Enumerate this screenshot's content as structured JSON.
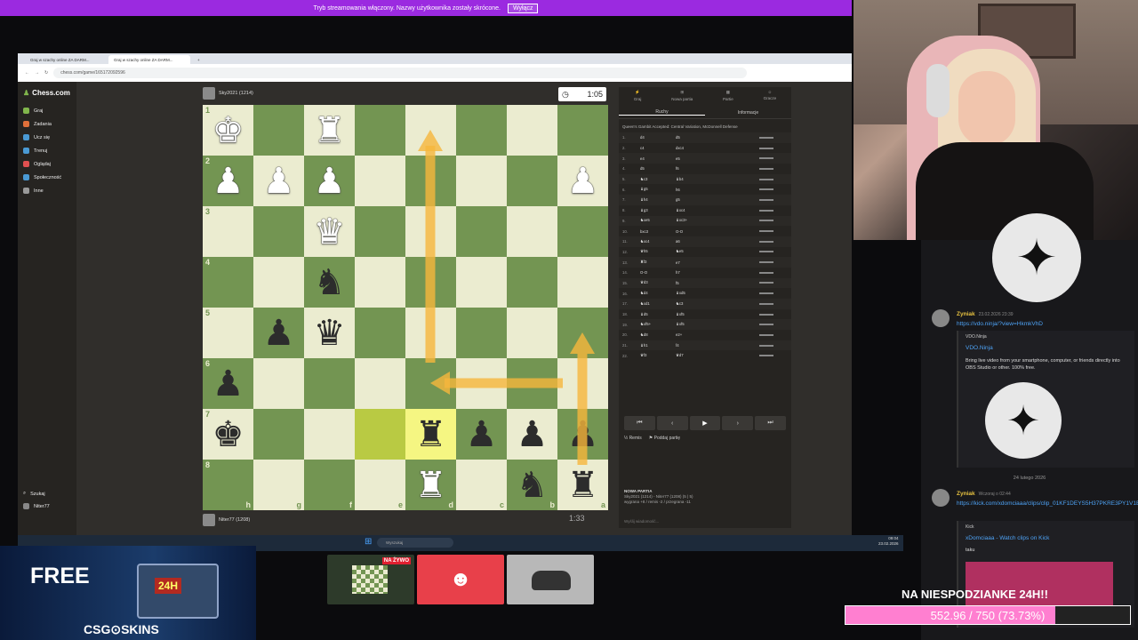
{
  "banner": {
    "text": "Tryb streamowania włączony. Nazwy użytkownika zostały skrócone.",
    "button": "Wyłącz"
  },
  "browser": {
    "tabs": [
      "Graj w szachy online ZA DARM...",
      "Graj w szachy online ZA DARM..."
    ],
    "url": "chess.com/game/165172092596"
  },
  "sidebar": {
    "logo": "Chess.com",
    "items": [
      {
        "label": "Graj",
        "color": "#81b64c"
      },
      {
        "label": "Zadania",
        "color": "#e0703a"
      },
      {
        "label": "Ucz się",
        "color": "#4a9ad4"
      },
      {
        "label": "Trenuj",
        "color": "#4a9ad4"
      },
      {
        "label": "Oglądaj",
        "color": "#e05050"
      },
      {
        "label": "Społeczność",
        "color": "#4a9ad4"
      },
      {
        "label": "Inne",
        "color": "#999999"
      }
    ],
    "search": "Szukaj",
    "user": "Niter77"
  },
  "top_player": {
    "name": "Sky2021 (1214)",
    "clock": "1:05"
  },
  "bottom_player": {
    "name": "Niter77 (1208)",
    "clock": "1:33"
  },
  "board": {
    "ranks": [
      "1",
      "2",
      "3",
      "4",
      "5",
      "6",
      "7",
      "8"
    ],
    "files": [
      "h",
      "g",
      "f",
      "e",
      "d",
      "c",
      "b",
      "a"
    ],
    "rows": [
      [
        "wK",
        "",
        "wR",
        "",
        "",
        "",
        "",
        ""
      ],
      [
        "wP",
        "wP",
        "wP",
        "",
        "",
        "",
        "",
        "wP"
      ],
      [
        "",
        "",
        "wQ",
        "",
        "",
        "",
        "",
        ""
      ],
      [
        "",
        "",
        "bN",
        "",
        "",
        "",
        "",
        ""
      ],
      [
        "",
        "bP",
        "bQ",
        "",
        "",
        "",
        "",
        ""
      ],
      [
        "bP",
        "",
        "",
        "",
        "",
        "",
        "",
        ""
      ],
      [
        "bK",
        "",
        "",
        "",
        "bR",
        "bP",
        "bP",
        "bP"
      ],
      [
        "",
        "",
        "",
        "",
        "wR",
        "",
        "bN",
        "bR"
      ]
    ],
    "highlights": [
      "6-3",
      "6-4"
    ]
  },
  "panel": {
    "tabs": [
      "Graj",
      "Nowa partia",
      "Partie",
      "Gracze"
    ],
    "subtabs": [
      "Ruchy",
      "Informacje"
    ],
    "opening": "Queen's Gambit Accepted: Central Variation, McDonnell Defense",
    "moves": [
      [
        "1.",
        "d4",
        "d5"
      ],
      [
        "2.",
        "c4",
        "dxc4"
      ],
      [
        "3.",
        "e4",
        "e5"
      ],
      [
        "4.",
        "d5",
        "f6"
      ],
      [
        "5.",
        "♞c3",
        "♝b4"
      ],
      [
        "6.",
        "♝g5",
        "h6"
      ],
      [
        "7.",
        "♝h4",
        "g5"
      ],
      [
        "8.",
        "♝g3",
        "♝xc4"
      ],
      [
        "9.",
        "♞xe5",
        "♝xc3+"
      ],
      [
        "10.",
        "bxc3",
        "O-O"
      ],
      [
        "11.",
        "♞xc4",
        "a6"
      ],
      [
        "12.",
        "♛h5",
        "♞e5"
      ],
      [
        "13.",
        "♜f3",
        "e7"
      ],
      [
        "14.",
        "O-O",
        "h7"
      ],
      [
        "15.",
        "♛d3",
        "f5"
      ],
      [
        "16.",
        "♞d4",
        "♝xd5"
      ],
      [
        "17.",
        "♞xd1",
        "♞c3"
      ],
      [
        "18.",
        "♝d5",
        "♝xf5"
      ],
      [
        "19.",
        "♞xf5+",
        "♝xf5"
      ],
      [
        "20.",
        "♞d8",
        "e2+"
      ],
      [
        "21.",
        "♝h1",
        "f4"
      ],
      [
        "22.",
        "♛f3",
        "♛d7"
      ]
    ],
    "nav": [
      "⏮",
      "‹",
      "▶",
      "›",
      "⏭"
    ],
    "draw": "Remis",
    "resign": "Poddaj partię",
    "gameinfo": {
      "title": "NOWA PARTIA",
      "line1": "Sky2021 (1214) - Niter77 (1208) (5 | 5)",
      "line2": "wygrana +8 / remis -2 / przegrana -11"
    },
    "message": "Wyślij wiadomość..."
  },
  "taskbar": {
    "search": "Wyszukaj",
    "time": "09:04",
    "date": "23.02.2026"
  },
  "chat": {
    "messages": [
      {
        "name": "Zyniak",
        "time": "23.02.2026 23:39",
        "link": "https://vdo.ninja/?view=HkmkVhD",
        "embed_site": "VDO.Ninja",
        "embed_title": "VDO.Ninja",
        "embed_desc": "Bring live video from your smartphone, computer, or friends directly into OBS Studio or other. 100% free."
      },
      {
        "name": "Zyniak",
        "time": "Wczoraj o 02:44",
        "link": "https://kick.com/xdomciaaa/clips/clip_01KF1DEYS5H37PKRE3PY1V1BNC",
        "embed_site": "Kick",
        "embed_title": "xDomciaaa - Watch clips on Kick",
        "embed_desc": "taku"
      }
    ],
    "date_sep": "24 lutego 2026"
  },
  "goal": {
    "title": "NA NIESPODZIANKE 24H!!",
    "text": "552.96 / 750 (73.73%)",
    "fraction": 0.7373,
    "color": "#ff7fd0"
  },
  "ad": {
    "free": "FREE",
    "box": "24H",
    "brand": "CSG⊙SKINS"
  },
  "scenes": {
    "live": "NA ŻYWO",
    "discord_icon": "discord-icon"
  }
}
